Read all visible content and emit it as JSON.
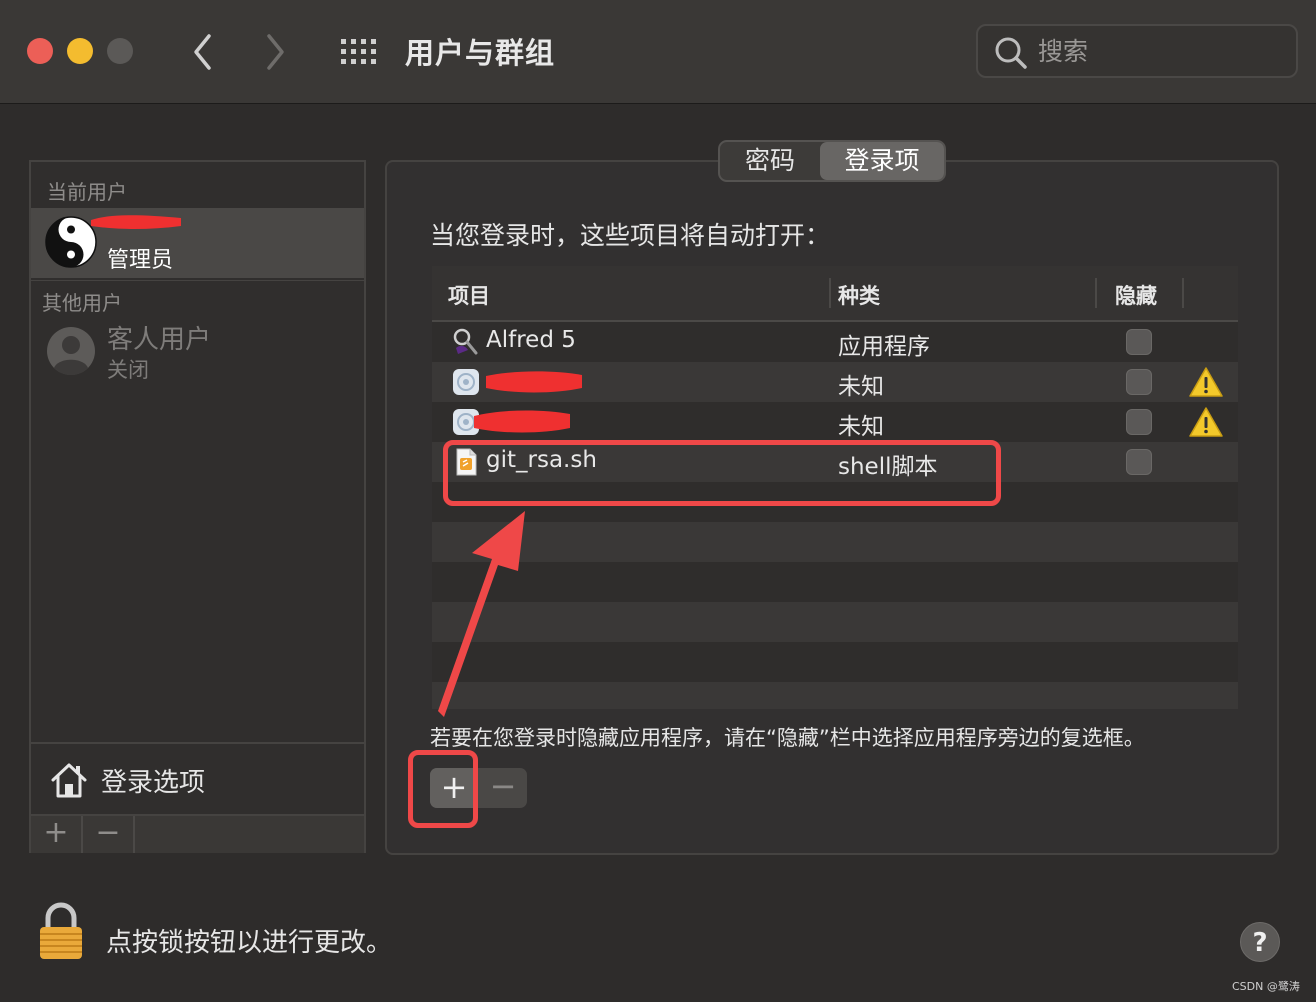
{
  "window": {
    "title": "用户与群组"
  },
  "search": {
    "placeholder": "搜索"
  },
  "sidebar": {
    "current_users_label": "当前用户",
    "current_user": {
      "role": "管理员"
    },
    "other_users_label": "其他用户",
    "guest": {
      "name": "客人用户",
      "status": "关闭"
    },
    "login_options_label": "登录选项",
    "add_label": "+",
    "remove_label": "−"
  },
  "tabs": {
    "password": "密码",
    "login_items": "登录项"
  },
  "login_items": {
    "intro": "当您登录时，这些项目将自动打开：",
    "columns": {
      "item": "项目",
      "kind": "种类",
      "hide": "隐藏"
    },
    "rows": [
      {
        "name": "Alfred 5",
        "kind": "应用程序",
        "icon": "alfred-icon",
        "warning": false
      },
      {
        "name": "",
        "kind": "未知",
        "icon": "generic-app-icon",
        "warning": true
      },
      {
        "name": "",
        "kind": "未知",
        "icon": "generic-app-icon",
        "warning": true
      },
      {
        "name": "git_rsa.sh",
        "kind": "shell脚本",
        "icon": "script-file-icon",
        "warning": false
      }
    ],
    "hint": "若要在您登录时隐藏应用程序，请在“隐藏”栏中选择应用程序旁边的复选框。",
    "add_label": "+",
    "remove_label": "−"
  },
  "lock": {
    "text": "点按锁按钮以进行更改。"
  },
  "help": {
    "label": "?"
  },
  "watermark": "CSDN @鹭涛",
  "colors": {
    "annotation_red": "#ef4848",
    "close": "#ec5f57",
    "minimize": "#f4bc2f"
  }
}
